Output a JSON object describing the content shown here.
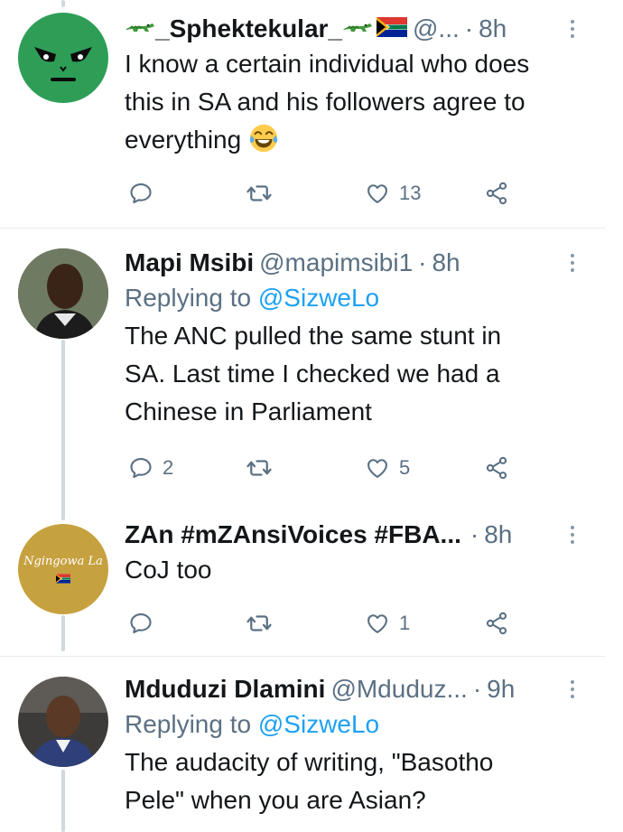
{
  "tweets": [
    {
      "name": "_Sphektekular_",
      "handle": "@...",
      "dot": "·",
      "time": "8h",
      "reply_prefix": "",
      "reply_mention": "",
      "text_lines": [
        "I know a certain individual who does",
        "this in SA and his followers agree to",
        "everything"
      ],
      "replies": "",
      "retweets": "",
      "likes": "13"
    },
    {
      "name": "Mapi Msibi",
      "handle": "@mapimsibi1",
      "dot": "·",
      "time": "8h",
      "reply_prefix": "Replying to ",
      "reply_mention": "@SizweLo",
      "text_lines": [
        "The ANC pulled the same stunt in",
        "SA. Last time I checked we had a",
        "Chinese in Parliament"
      ],
      "replies": "2",
      "retweets": "",
      "likes": "5"
    },
    {
      "name": "ZAn #mZAnsiVoices #FBA...",
      "handle": "",
      "dot": "·",
      "time": "8h",
      "reply_prefix": "",
      "reply_mention": "",
      "avatar_text": "Ngingowa La",
      "text_lines": [
        "CoJ too"
      ],
      "replies": "",
      "retweets": "",
      "likes": "1"
    },
    {
      "name": "Mduduzi Dlamini",
      "handle": "@Mduduz...",
      "dot": "·",
      "time": "9h",
      "reply_prefix": "Replying to ",
      "reply_mention": "@SizweLo",
      "text_lines": [
        "The audacity of writing, \"Basotho",
        "Pele\" when you are Asian?"
      ]
    }
  ],
  "colors": {
    "accent": "#1da1f2",
    "muted": "#5b7083",
    "divider": "#e6ecf0",
    "thread_line": "#cfd9de",
    "avatar1": "#2e9e57",
    "avatar3": "#c6a13f"
  },
  "icons": [
    "reply-icon",
    "retweet-icon",
    "like-icon",
    "share-icon",
    "more-icon",
    "crocodile-icon",
    "south-africa-flag-icon",
    "laughing-emoji-icon"
  ]
}
